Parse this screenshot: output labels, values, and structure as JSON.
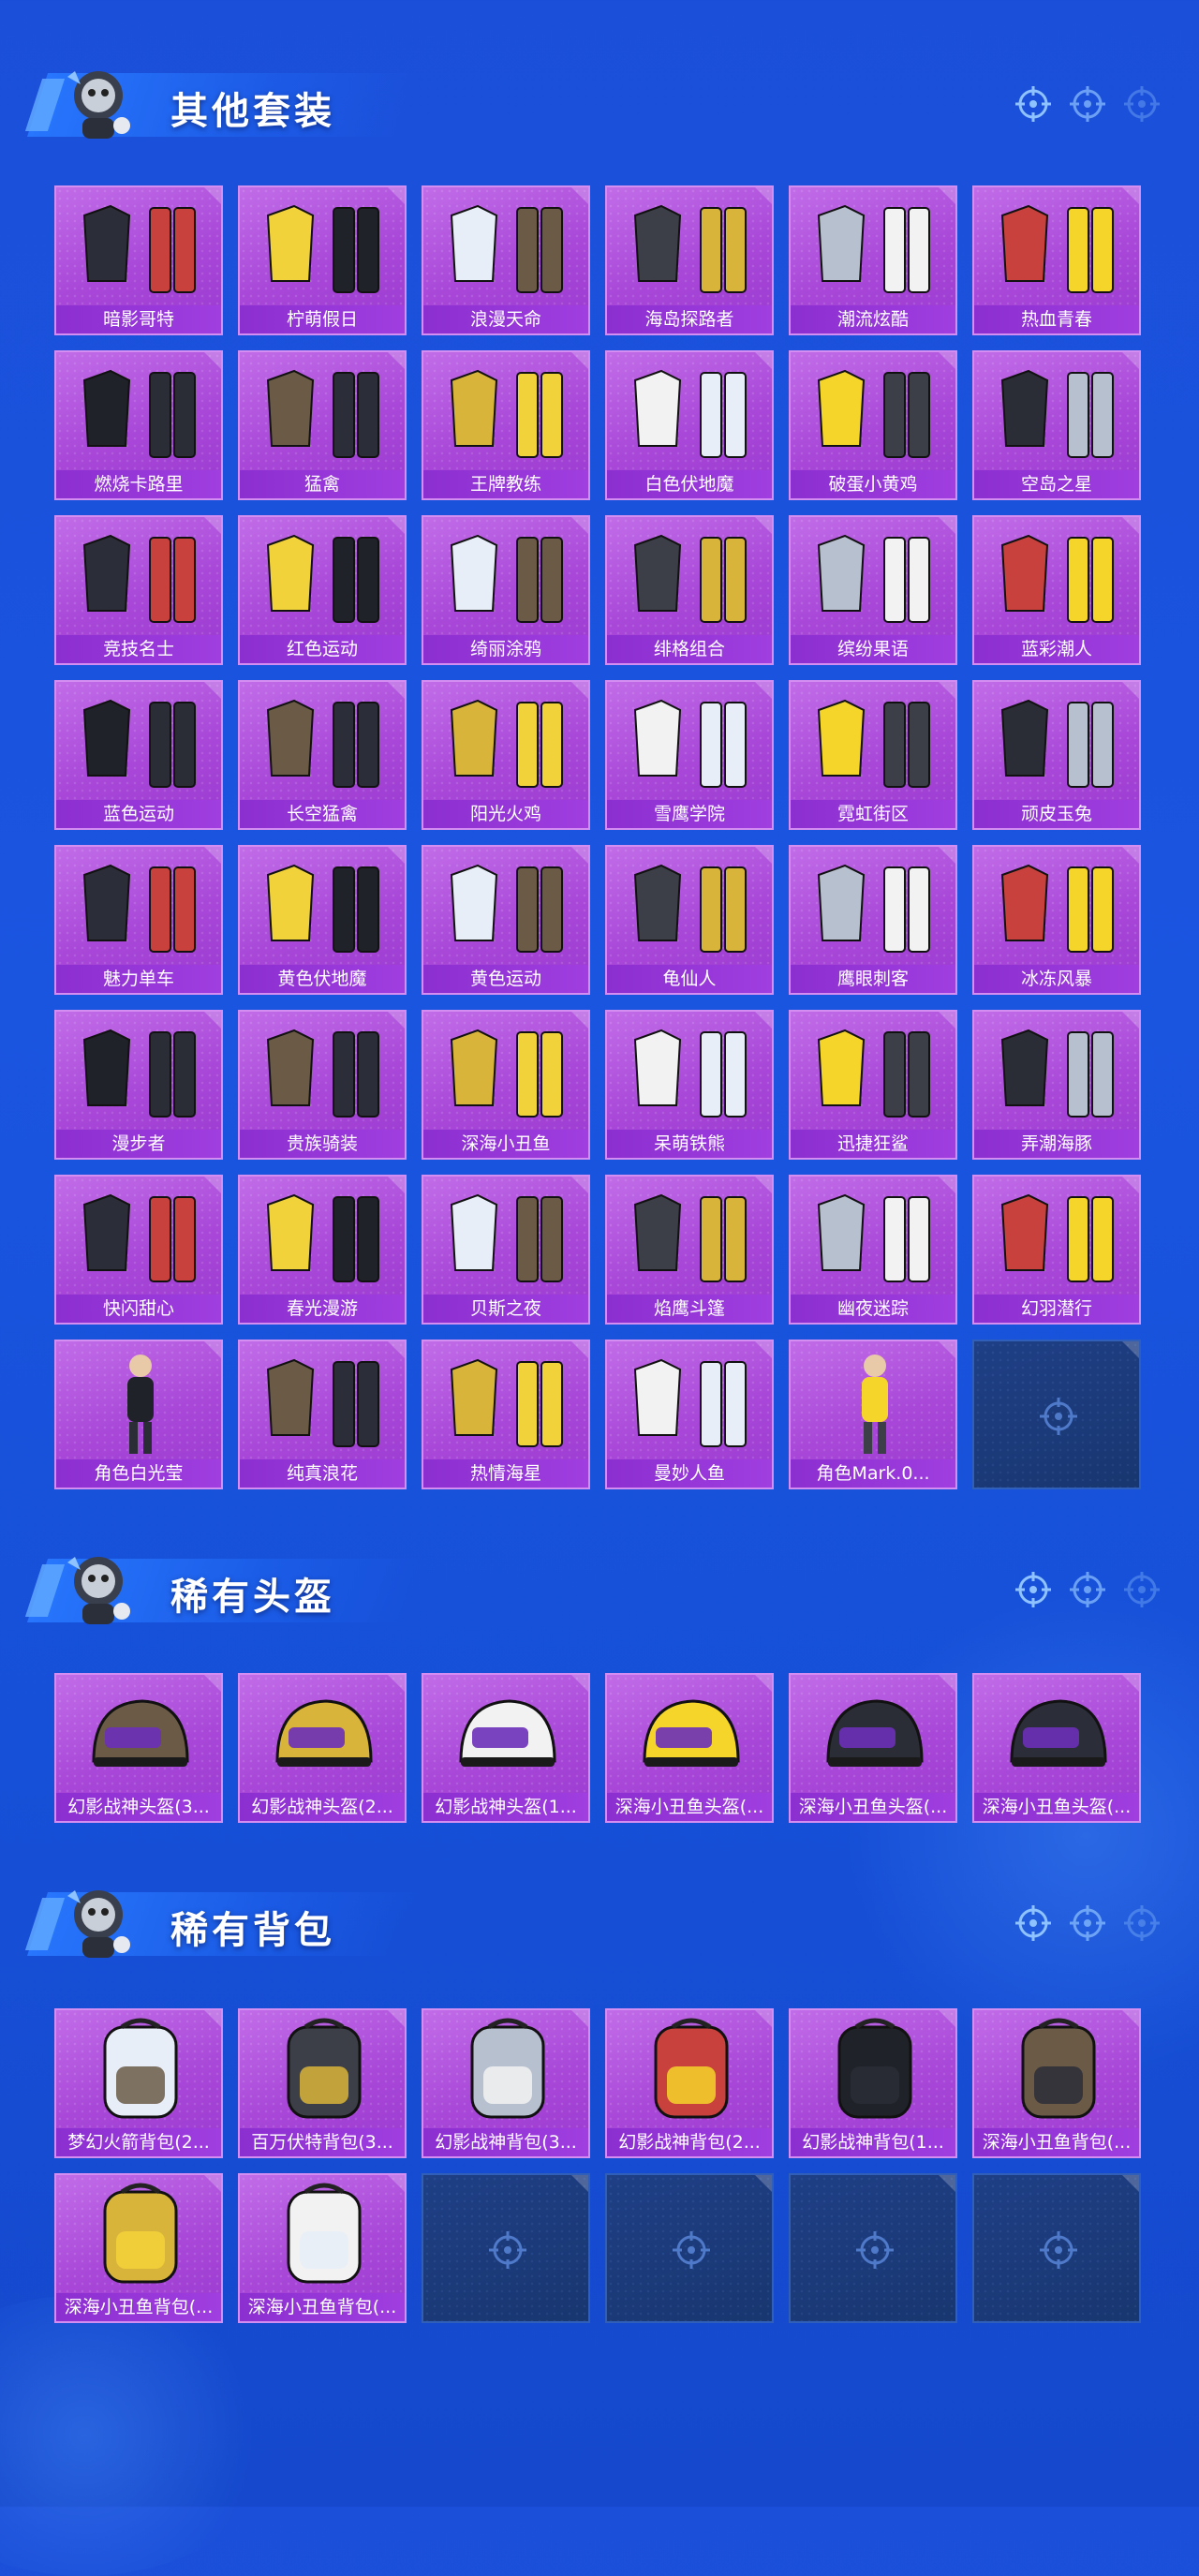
{
  "sections": [
    {
      "title": "其他套装",
      "items": [
        {
          "label": "暗影哥特",
          "icon": "outfit-icon"
        },
        {
          "label": "柠萌假日",
          "icon": "outfit-icon"
        },
        {
          "label": "浪漫天命",
          "icon": "outfit-icon"
        },
        {
          "label": "海岛探路者",
          "icon": "outfit-icon"
        },
        {
          "label": "潮流炫酷",
          "icon": "outfit-icon"
        },
        {
          "label": "热血青春",
          "icon": "outfit-icon"
        },
        {
          "label": "燃烧卡路里",
          "icon": "outfit-icon"
        },
        {
          "label": "猛禽",
          "icon": "outfit-icon"
        },
        {
          "label": "王牌教练",
          "icon": "outfit-icon"
        },
        {
          "label": "白色伏地魔",
          "icon": "outfit-icon"
        },
        {
          "label": "破蛋小黄鸡",
          "icon": "outfit-icon"
        },
        {
          "label": "空岛之星",
          "icon": "outfit-icon"
        },
        {
          "label": "竞技名士",
          "icon": "outfit-icon"
        },
        {
          "label": "红色运动",
          "icon": "outfit-icon"
        },
        {
          "label": "绮丽涂鸦",
          "icon": "outfit-icon"
        },
        {
          "label": "绯格组合",
          "icon": "outfit-icon"
        },
        {
          "label": "缤纷果语",
          "icon": "outfit-icon"
        },
        {
          "label": "蓝彩潮人",
          "icon": "outfit-icon"
        },
        {
          "label": "蓝色运动",
          "icon": "outfit-icon"
        },
        {
          "label": "长空猛禽",
          "icon": "outfit-icon"
        },
        {
          "label": "阳光火鸡",
          "icon": "outfit-icon"
        },
        {
          "label": "雪鹰学院",
          "icon": "outfit-icon"
        },
        {
          "label": "霓虹街区",
          "icon": "outfit-icon"
        },
        {
          "label": "顽皮玉兔",
          "icon": "outfit-icon"
        },
        {
          "label": "魅力单车",
          "icon": "outfit-icon"
        },
        {
          "label": "黄色伏地魔",
          "icon": "outfit-icon"
        },
        {
          "label": "黄色运动",
          "icon": "outfit-icon"
        },
        {
          "label": "龟仙人",
          "icon": "outfit-icon"
        },
        {
          "label": "鹰眼刺客",
          "icon": "outfit-icon"
        },
        {
          "label": "冰冻风暴",
          "icon": "outfit-icon"
        },
        {
          "label": "漫步者",
          "icon": "outfit-icon"
        },
        {
          "label": "贵族骑装",
          "icon": "outfit-icon"
        },
        {
          "label": "深海小丑鱼",
          "icon": "outfit-icon"
        },
        {
          "label": "呆萌铁熊",
          "icon": "outfit-icon"
        },
        {
          "label": "迅捷狂鲨",
          "icon": "outfit-icon"
        },
        {
          "label": "弄潮海豚",
          "icon": "outfit-icon"
        },
        {
          "label": "快闪甜心",
          "icon": "outfit-icon"
        },
        {
          "label": "春光漫游",
          "icon": "outfit-icon"
        },
        {
          "label": "贝斯之夜",
          "icon": "outfit-icon"
        },
        {
          "label": "焰鹰斗篷",
          "icon": "outfit-icon"
        },
        {
          "label": "幽夜迷踪",
          "icon": "outfit-icon"
        },
        {
          "label": "幻羽潜行",
          "icon": "outfit-icon"
        },
        {
          "label": "角色白光莹",
          "icon": "character-icon"
        },
        {
          "label": "纯真浪花",
          "icon": "outfit-icon"
        },
        {
          "label": "热情海星",
          "icon": "outfit-icon"
        },
        {
          "label": "曼妙人鱼",
          "icon": "outfit-icon"
        },
        {
          "label": "角色Mark.0...",
          "icon": "character-icon"
        },
        {
          "label": "",
          "empty": true
        }
      ]
    },
    {
      "title": "稀有头盔",
      "items": [
        {
          "label": "幻影战神头盔(3...",
          "icon": "helmet-icon"
        },
        {
          "label": "幻影战神头盔(2...",
          "icon": "helmet-icon"
        },
        {
          "label": "幻影战神头盔(1...",
          "icon": "helmet-icon"
        },
        {
          "label": "深海小丑鱼头盔(...",
          "icon": "helmet-icon"
        },
        {
          "label": "深海小丑鱼头盔(...",
          "icon": "helmet-icon"
        },
        {
          "label": "深海小丑鱼头盔(...",
          "icon": "helmet-icon"
        }
      ]
    },
    {
      "title": "稀有背包",
      "items": [
        {
          "label": "梦幻火箭背包(2...",
          "icon": "backpack-icon"
        },
        {
          "label": "百万伏特背包(3...",
          "icon": "backpack-icon"
        },
        {
          "label": "幻影战神背包(3...",
          "icon": "backpack-icon"
        },
        {
          "label": "幻影战神背包(2...",
          "icon": "backpack-icon"
        },
        {
          "label": "幻影战神背包(1...",
          "icon": "backpack-icon"
        },
        {
          "label": "深海小丑鱼背包(...",
          "icon": "backpack-icon"
        },
        {
          "label": "深海小丑鱼背包(...",
          "icon": "backpack-icon"
        },
        {
          "label": "深海小丑鱼背包(...",
          "icon": "backpack-icon"
        },
        {
          "label": "",
          "empty": true
        },
        {
          "label": "",
          "empty": true
        },
        {
          "label": "",
          "empty": true
        },
        {
          "label": "",
          "empty": true
        }
      ]
    }
  ],
  "colors": {
    "background": "#1a55e0",
    "tile": "#a847d8",
    "tile_label_bar": "#8c2fd0",
    "empty_tile": "#1f3f86"
  }
}
